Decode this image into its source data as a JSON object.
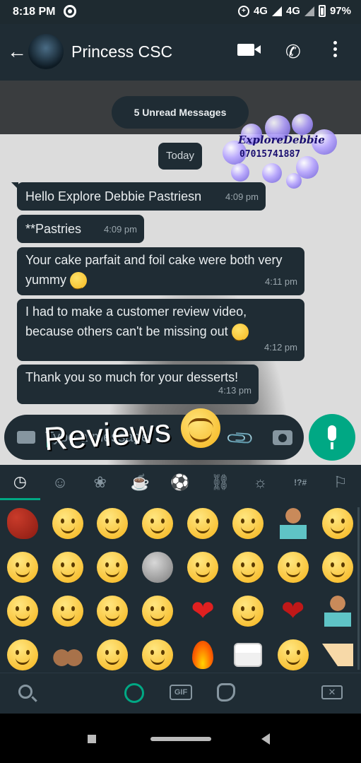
{
  "status_bar": {
    "time": "8:18 PM",
    "network_1": "4G",
    "network_2": "4G",
    "battery": "97%"
  },
  "header": {
    "contact_name": "Princess CSC",
    "back_icon": "arrow-left-icon",
    "icons": [
      "video-call-icon",
      "voice-call-icon",
      "more-options-icon"
    ]
  },
  "chat": {
    "unread_banner": "5 Unread Messages",
    "date_chip": "Today",
    "messages": [
      {
        "text": "Hello Explore Debbie Pastriesn",
        "time": "4:09 pm"
      },
      {
        "text": "**Pastries",
        "time": "4:09 pm"
      },
      {
        "text": "Your cake parfait and foil cake were both very yummy",
        "time": "4:11 pm",
        "emoji": "smiling-face-icon"
      },
      {
        "text": "I had to make a customer review video, because others can't be missing out",
        "time": "4:12 pm",
        "emoji": "weary-face-icon"
      },
      {
        "text": "Thank you so much for your desserts!",
        "time": "4:13 pm"
      }
    ],
    "watermark": {
      "brand": "ExploreDebbie",
      "phone": "07015741887"
    }
  },
  "composer": {
    "placeholder": "Type a message",
    "overlay_caption": "Reviews"
  },
  "emoji_keyboard": {
    "categories": [
      "recent",
      "smileys",
      "animals",
      "food",
      "activity",
      "travel",
      "objects",
      "symbols",
      "flags"
    ],
    "active_category": "recent",
    "gif_label": "GIF",
    "emojis": [
      "woman-dancing",
      "face-with-tears-of-joy",
      "star-struck",
      "face-savoring-food",
      "smirking-face",
      "drooling-face",
      "person-shrugging",
      "rolling-on-floor-laughing",
      "sad-relieved-face",
      "smiling-face",
      "grinning-face-with-sweat",
      "new-moon-face",
      "zany-face",
      "smiling-face-with-smiling-eyes",
      "money-mouth-face",
      "weary-face",
      "smiling-face-with-hearts",
      "pleading-face",
      "yawning-face",
      "sneezing-face",
      "red-heart",
      "face-holding-back-tears",
      "broken-heart",
      "person-facepalming",
      "thinking-face",
      "raising-hands",
      "beaming-face",
      "partying-face",
      "fire",
      "birthday-cake",
      "neutral-face",
      "shortcake"
    ]
  },
  "colors": {
    "accent": "#00a884",
    "bubble": "#1f2c34",
    "header": "#1f2c34",
    "text_primary": "#e9edef",
    "text_secondary": "#8696a0"
  }
}
